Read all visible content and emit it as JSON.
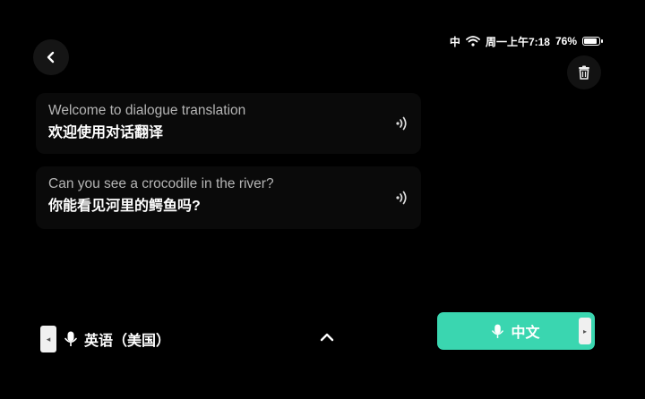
{
  "status_bar": {
    "ime": "中",
    "clock": "周一上午7:18",
    "battery_percent": "76%",
    "battery_level": 0.76,
    "icons": [
      "wifi-icon",
      "battery-icon"
    ]
  },
  "header": {
    "back_icon": "chevron-left-icon",
    "clear_icon": "trash-icon"
  },
  "messages": [
    {
      "source_text": "Welcome to dialogue translation",
      "target_text": "欢迎使用对话翻译",
      "speaker_icon": "speaker-icon"
    },
    {
      "source_text": "Can you see a crocodile in the river?",
      "target_text": "你能看见河里的鳄鱼吗?",
      "speaker_icon": "speaker-icon"
    }
  ],
  "bottom_bar": {
    "left_language": "英语（美国）",
    "right_language": "中文",
    "mic_icon": "microphone-icon",
    "expand_icon": "chevron-up-icon",
    "accent_color": "#3ad6b0"
  }
}
